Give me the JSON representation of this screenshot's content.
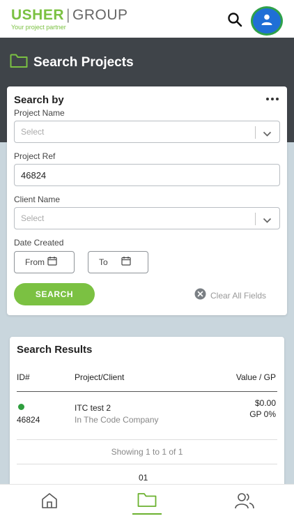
{
  "app": {
    "brand_primary": "USHER",
    "brand_separator": "|",
    "brand_secondary": "GROUP",
    "tagline": "Your project partner",
    "accent_color": "#7bc142"
  },
  "topbar": {
    "search_icon": "search-icon",
    "avatar_icon": "user-icon"
  },
  "page": {
    "title": "Search Projects",
    "icon": "folder-icon"
  },
  "search": {
    "title": "Search by",
    "project_name_label": "Project Name",
    "project_name_placeholder": "Select",
    "project_ref_label": "Project Ref",
    "project_ref_value": "46824",
    "client_name_label": "Client Name",
    "client_name_placeholder": "Select",
    "date_created_label": "Date Created",
    "from_label": "From",
    "to_label": "To",
    "search_button": "SEARCH",
    "clear_label": "Clear All Fields"
  },
  "results": {
    "title": "Search Results",
    "columns": {
      "id": "ID#",
      "project": "Project/Client",
      "value": "Value / GP"
    },
    "rows": [
      {
        "status_color": "#2e9e3e",
        "id": "46824",
        "project": "ITC test 2",
        "client": "In The Code Company",
        "value": "$0.00",
        "gp": "GP 0%"
      }
    ],
    "showing": "Showing 1 to 1 of 1",
    "page": "01"
  },
  "nav": {
    "items": [
      {
        "icon": "home-icon",
        "active": false
      },
      {
        "icon": "folder-icon",
        "active": true
      },
      {
        "icon": "users-icon",
        "active": false
      }
    ]
  }
}
